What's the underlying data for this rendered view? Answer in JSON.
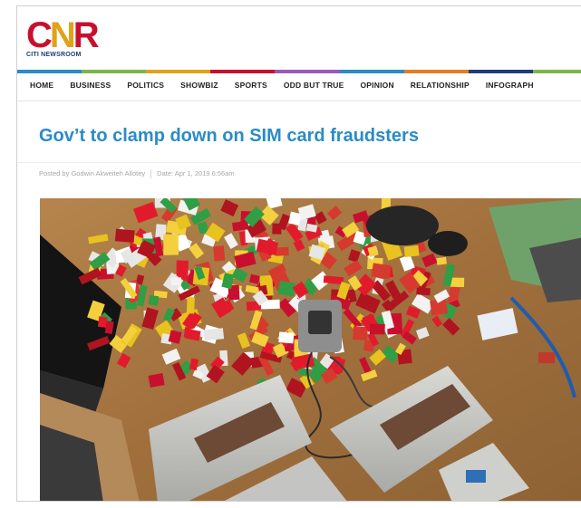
{
  "brand": {
    "logo_text": "CNR",
    "logo_sub": "CITI NEWSROOM",
    "colors": {
      "red": "#c8102e",
      "gold": "#e0a21a",
      "navy": "#1f3b78"
    }
  },
  "nav": {
    "items": [
      "HOME",
      "BUSINESS",
      "POLITICS",
      "SHOWBIZ",
      "SPORTS",
      "ODD BUT TRUE",
      "OPINION",
      "RELATIONSHIP",
      "INFOGRAPH"
    ],
    "accent_colors": [
      "#2a8bc8",
      "#7ab648",
      "#e0a21a",
      "#c8102e",
      "#9b59b6",
      "#2a8bc8",
      "#e67e22",
      "#1f3b78",
      "#7ab648"
    ]
  },
  "article": {
    "headline": "Gov’t to clamp down on SIM card fraudsters",
    "author": "Posted by Godwin Akweiteh Allotey",
    "date": "Date: Apr 1, 2019 6:56am",
    "headline_color": "#2a8bc8"
  },
  "image": {
    "subject": "seized SIM cards and SIM box devices on a table"
  }
}
